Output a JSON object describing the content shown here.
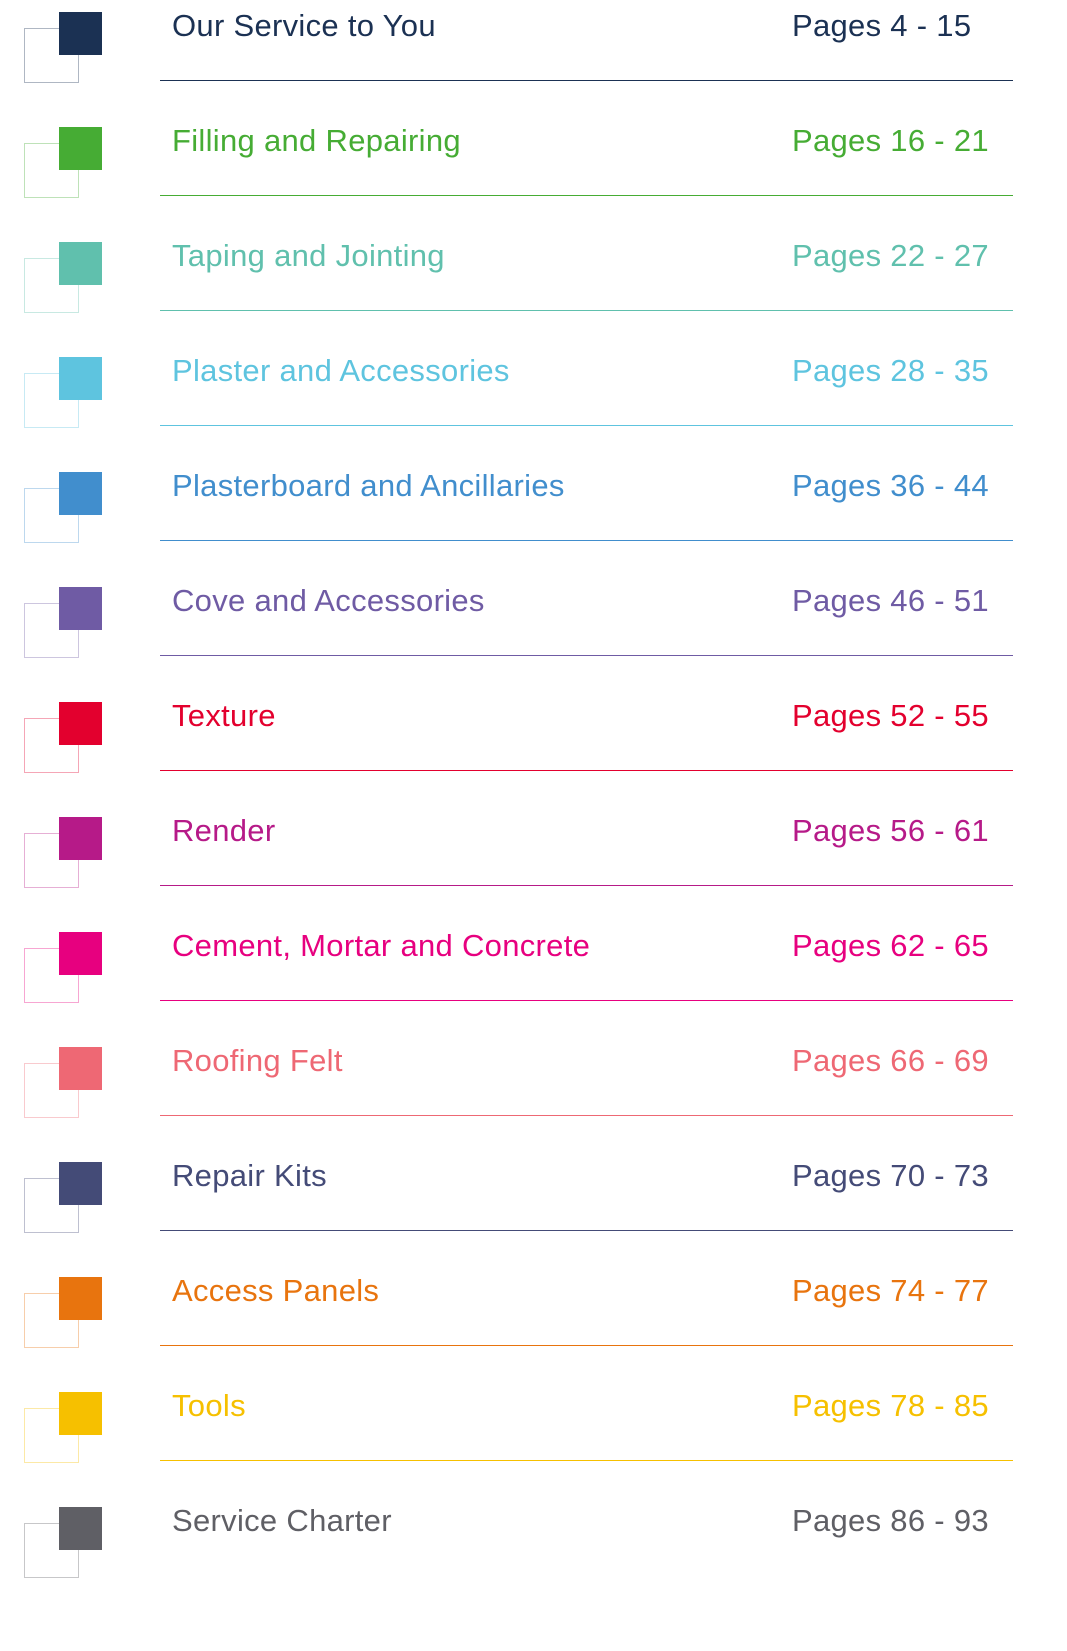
{
  "toc": {
    "entries": [
      {
        "title": "Our Service to You",
        "pages": "Pages 4 - 15",
        "color": "#1b3153"
      },
      {
        "title": "Filling and Repairing",
        "pages": "Pages 16 - 21",
        "color": "#46ac34"
      },
      {
        "title": "Taping and Jointing",
        "pages": "Pages 22 - 27",
        "color": "#60c0ad"
      },
      {
        "title": "Plaster and Accessories",
        "pages": "Pages 28 - 35",
        "color": "#5ec4df"
      },
      {
        "title": "Plasterboard and Ancillaries",
        "pages": "Pages 36 - 44",
        "color": "#418ecd"
      },
      {
        "title": "Cove and Accessories",
        "pages": "Pages 46 - 51",
        "color": "#6f5ba4"
      },
      {
        "title": "Texture",
        "pages": "Pages 52 - 55",
        "color": "#e3002e"
      },
      {
        "title": "Render",
        "pages": "Pages 56 - 61",
        "color": "#b61a88"
      },
      {
        "title": "Cement, Mortar and Concrete",
        "pages": "Pages 62 - 65",
        "color": "#e7007f"
      },
      {
        "title": "Roofing Felt",
        "pages": "Pages 66 - 69",
        "color": "#ee6874"
      },
      {
        "title": "Repair Kits",
        "pages": "Pages 70 - 73",
        "color": "#444b77"
      },
      {
        "title": "Access Panels",
        "pages": "Pages 74 - 77",
        "color": "#e8740e"
      },
      {
        "title": "Tools",
        "pages": "Pages 78 - 85",
        "color": "#f6c000"
      },
      {
        "title": "Service Charter",
        "pages": "Pages 86 - 93",
        "color": "#5f5f65"
      }
    ]
  }
}
